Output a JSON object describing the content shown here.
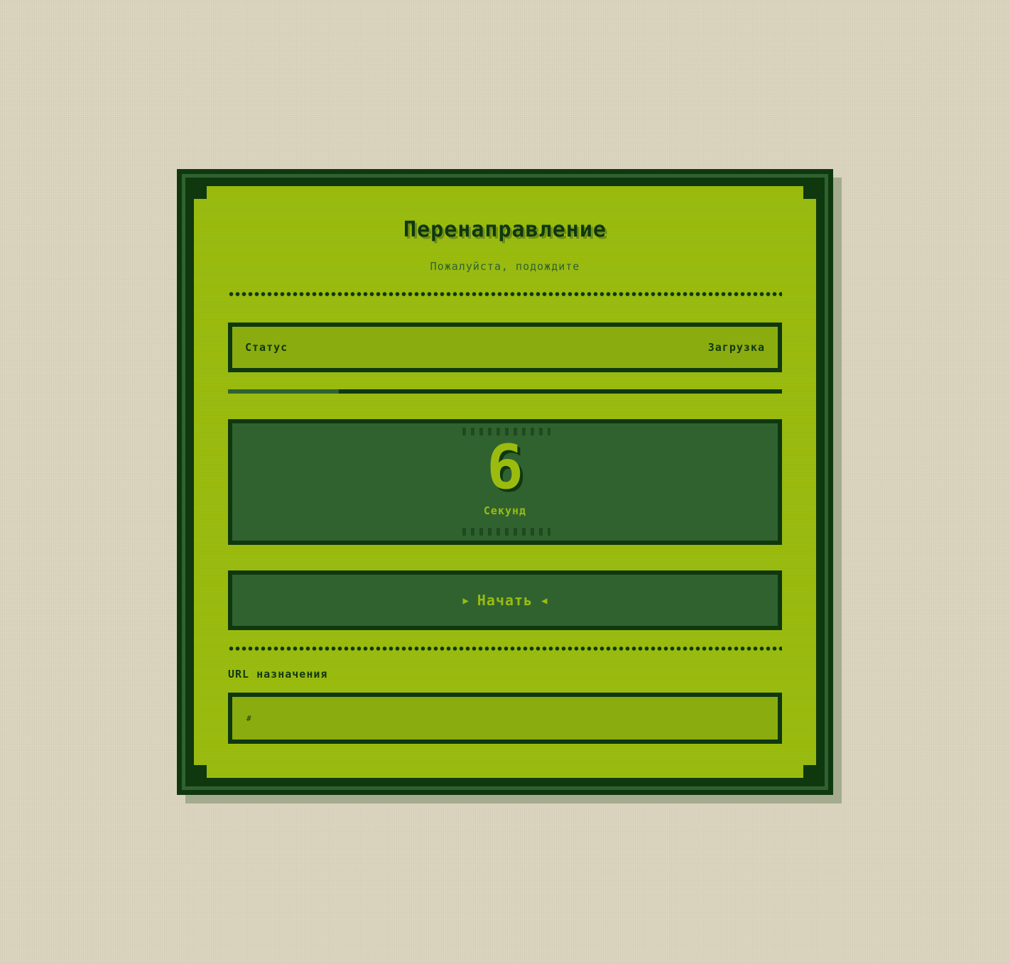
{
  "header": {
    "title": "Перенаправление",
    "subtitle": "Пожалуйста, подождите"
  },
  "status": {
    "label": "Статус",
    "value": "Загрузка"
  },
  "progress": {
    "fraction": 0.2
  },
  "countdown": {
    "value": "6",
    "unit": "Секунд"
  },
  "start_button": {
    "label": "Начать",
    "left_icon": "triangle-right-icon",
    "right_icon": "triangle-left-icon"
  },
  "destination": {
    "label": "URL назначения",
    "value": "#"
  },
  "colors": {
    "darkest": "#0f380f",
    "dark": "#306230",
    "light": "#8bac0f",
    "lightest": "#9bbc0f",
    "background": "#dcd6c0"
  }
}
